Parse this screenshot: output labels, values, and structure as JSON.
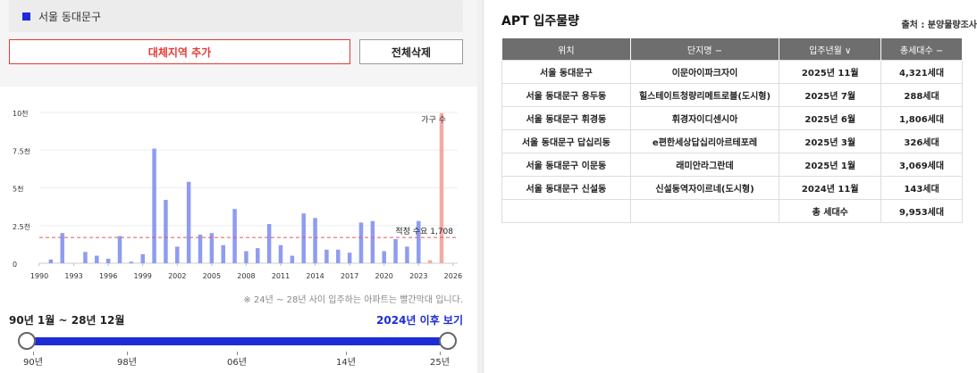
{
  "region": {
    "label": "서울 동대문구",
    "marker_color": "#1d2cd6"
  },
  "buttons": {
    "add_label": "대체지역 추가",
    "delete_label": "전체삭제"
  },
  "chart_data": {
    "type": "bar",
    "unit_label": "가구 수",
    "yticks": [
      "0",
      "2.5천",
      "5천",
      "7.5천",
      "10천"
    ],
    "ylim": [
      0,
      10000
    ],
    "xtick_labels": [
      "1990",
      "1993",
      "1996",
      "1999",
      "2002",
      "2005",
      "2008",
      "2011",
      "2014",
      "2017",
      "2020",
      "2023",
      "2026"
    ],
    "x": [
      1991,
      1992,
      1993,
      1994,
      1995,
      1996,
      1997,
      1998,
      1999,
      2000,
      2001,
      2002,
      2003,
      2004,
      2005,
      2006,
      2007,
      2008,
      2009,
      2010,
      2011,
      2012,
      2013,
      2014,
      2015,
      2016,
      2017,
      2018,
      2019,
      2020,
      2021,
      2022,
      2023,
      2024,
      2025
    ],
    "values": [
      250,
      2000,
      0,
      750,
      500,
      300,
      1800,
      100,
      600,
      7600,
      4200,
      1100,
      5400,
      1900,
      2000,
      1200,
      3600,
      800,
      1000,
      2600,
      1200,
      500,
      3300,
      3000,
      900,
      900,
      700,
      2700,
      2800,
      800,
      1600,
      1100,
      2800,
      200,
      9953
    ],
    "highlight_from": 2024,
    "bar_color": "#8e9cf0",
    "highlight_color": "#f6aaa5",
    "reference_line": {
      "value": 1708,
      "label": "적정 수요 1,708",
      "color": "#e35a5a"
    }
  },
  "note": "※ 24년 ~ 28년 사이 입주하는 아파트는 빨간막대 입니다.",
  "range": {
    "label": "90년 1월 ~ 28년 12월",
    "link": "2024년 이후 보기",
    "ticks": [
      "90년",
      "98년",
      "06년",
      "14년",
      "25년"
    ]
  },
  "apt": {
    "title": "APT 입주물량",
    "source": "출처 : 분양물량조사",
    "headers": [
      "위치",
      "단지명 −",
      "입주년월 ∨",
      "총세대수 −"
    ],
    "rows": [
      [
        "서울 동대문구",
        "이문아이파크자이",
        "2025년 11월",
        "4,321세대"
      ],
      [
        "서울 동대문구 용두동",
        "힐스테이트청량리메트로블(도시형)",
        "2025년 7월",
        "288세대"
      ],
      [
        "서울 동대문구 휘경동",
        "휘경자이디센시아",
        "2025년 6월",
        "1,806세대"
      ],
      [
        "서울 동대문구 답십리동",
        "e편한세상답십리아르테포레",
        "2025년 3월",
        "326세대"
      ],
      [
        "서울 동대문구 이문동",
        "래미안라그란데",
        "2025년 1월",
        "3,069세대"
      ],
      [
        "서울 동대문구 신설동",
        "신설동역자이르네(도시형)",
        "2024년 11월",
        "143세대"
      ]
    ],
    "total_label": "총 세대수",
    "total_value": "9,953세대"
  }
}
